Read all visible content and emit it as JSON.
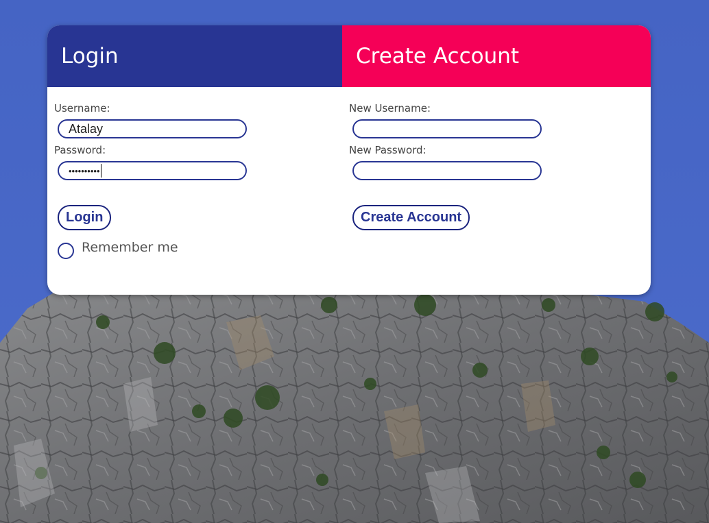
{
  "colors": {
    "login_tab": "#283593",
    "create_tab": "#f50057",
    "accent_border": "#283593",
    "sky": "#4a68c6"
  },
  "tabs": {
    "login": "Login",
    "create": "Create Account"
  },
  "login": {
    "username_label": "Username:",
    "username_value": "Atalay",
    "password_label": "Password:",
    "password_value": "••••••••••",
    "button_label": "Login",
    "remember_label": "Remember me"
  },
  "create": {
    "username_label": "New Username:",
    "username_value": "",
    "password_label": "New Password:",
    "password_value": "",
    "button_label": "Create Account"
  }
}
